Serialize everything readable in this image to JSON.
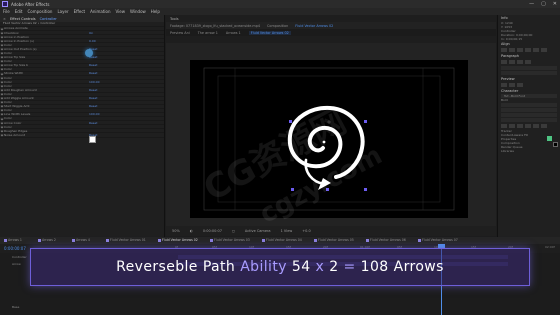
{
  "window": {
    "title": "Adobe After Effects",
    "controls": [
      "—",
      "▢",
      "✕"
    ]
  },
  "menu": [
    "File",
    "Edit",
    "Composition",
    "Layer",
    "Effect",
    "Animation",
    "View",
    "Window",
    "Help"
  ],
  "effect_controls": {
    "tab_close": "×",
    "tab_label": "Effect Controls",
    "tab_layer": "Controller",
    "crumb": "Fluid Vector Arrows 02 • Controller",
    "properties": [
      {
        "name": "Arrows Animate",
        "value": ""
      },
      {
        "name": "Checkbox",
        "value": "On"
      },
      {
        "name": "Arrow in Position",
        "value": ""
      },
      {
        "name": "Arrow In Position (s)",
        "value": "0.00"
      },
      {
        "name": "Color",
        "value": ""
      },
      {
        "name": "Arrow Out Position (s)",
        "value": "Reset"
      },
      {
        "name": "Color",
        "value": ""
      },
      {
        "name": "Arrow Tip Size",
        "value": "Reset"
      },
      {
        "name": "Color",
        "value": ""
      },
      {
        "name": "Arrow Tip Size b",
        "value": "Reset"
      },
      {
        "name": "Color",
        "value": ""
      },
      {
        "name": "Stroke Width",
        "value": "Reset"
      },
      {
        "name": "Color",
        "value": ""
      },
      {
        "name": "Color",
        "value": "100.00"
      },
      {
        "name": "Color",
        "value": ""
      },
      {
        "name": "Add Roughen Amount",
        "value": "Reset"
      },
      {
        "name": "Color",
        "value": ""
      },
      {
        "name": "Add Wiggle Amount",
        "value": "Reset"
      },
      {
        "name": "Color",
        "value": ""
      },
      {
        "name": "Start Wiggle Amt",
        "value": "Reset"
      },
      {
        "name": "Color",
        "value": ""
      },
      {
        "name": "Line Width Levels",
        "value": "100.00"
      },
      {
        "name": "Color",
        "value": ""
      },
      {
        "name": "Arrow Color",
        "value": "Reset"
      },
      {
        "name": "Color",
        "value": ""
      },
      {
        "name": "Roughen Edges",
        "value": ""
      },
      {
        "name": "Noise Amount",
        "value": "Reset"
      }
    ]
  },
  "project": {
    "panel_title": "Tools",
    "footage_tab": "Footage: 0771839_zlogo_lfu_stacked_oceanside.mp4",
    "comp_label": "Composition",
    "comp_name": "Fluid Vector Arrows 02",
    "flow_tabs": [
      "Preview Ani",
      "The arrow 1",
      "Arrows 1",
      "Fluid Vector Arrows 02"
    ]
  },
  "viewer_bar": [
    "50%",
    "◐",
    "0:00:00:07",
    "◻",
    "Active Camera",
    "1 View",
    "+0.0"
  ],
  "right_panel": {
    "info_title": "Info",
    "audio_title": "Audio",
    "align_title": "Align",
    "paragraph_title": "Paragraph",
    "preview_title": "Preview",
    "character_title": "Character",
    "font_name": "Tuf...Bold Font",
    "font_style": "Bold",
    "info_lines": [
      "X: 1240",
      "Y: 1053",
      "Controller",
      "Duration: 0;00;00;00",
      "In: 0;00;00;15"
    ],
    "extra_lines": [
      "Tracker",
      "Content-Aware Fill",
      "Properties",
      "Composition",
      "Render Queue",
      "Libraries"
    ]
  },
  "timeline": {
    "timecode": "0:00:00:07",
    "tabs": [
      "Arrows 1",
      "Arrows 2",
      "Arrows 4",
      "Fluid Vector Arrows 01",
      "Fluid Vector Arrows 02",
      "Fluid Vector Arrows 03",
      "Fluid Vector Arrows 04",
      "Fluid Vector Arrows 05",
      "Fluid Vector Arrows 06",
      "Fluid Vector Arrows 07"
    ],
    "ruler": [
      "0f",
      "05f",
      "10f",
      "15f",
      "20f",
      "01:00f",
      "05f",
      "10f",
      "15f",
      "20f",
      "02:00f"
    ],
    "layers": [
      "Controller",
      "Arrow",
      "Base"
    ]
  },
  "banner": {
    "word1": "Reverseble",
    "word2": "Path",
    "word3": "Ability",
    "n1": "54",
    "times": "x",
    "n2": "2",
    "eq": "=",
    "total": "108",
    "word4": "Arrows"
  },
  "watermarks": [
    "CG资源网",
    "cgzy.com"
  ],
  "colors": {
    "accent": "#6e5fd8",
    "banner_accent": "#a99cff",
    "selection_blue": "#4f8ee8",
    "arrow_white": "#ffffff"
  }
}
